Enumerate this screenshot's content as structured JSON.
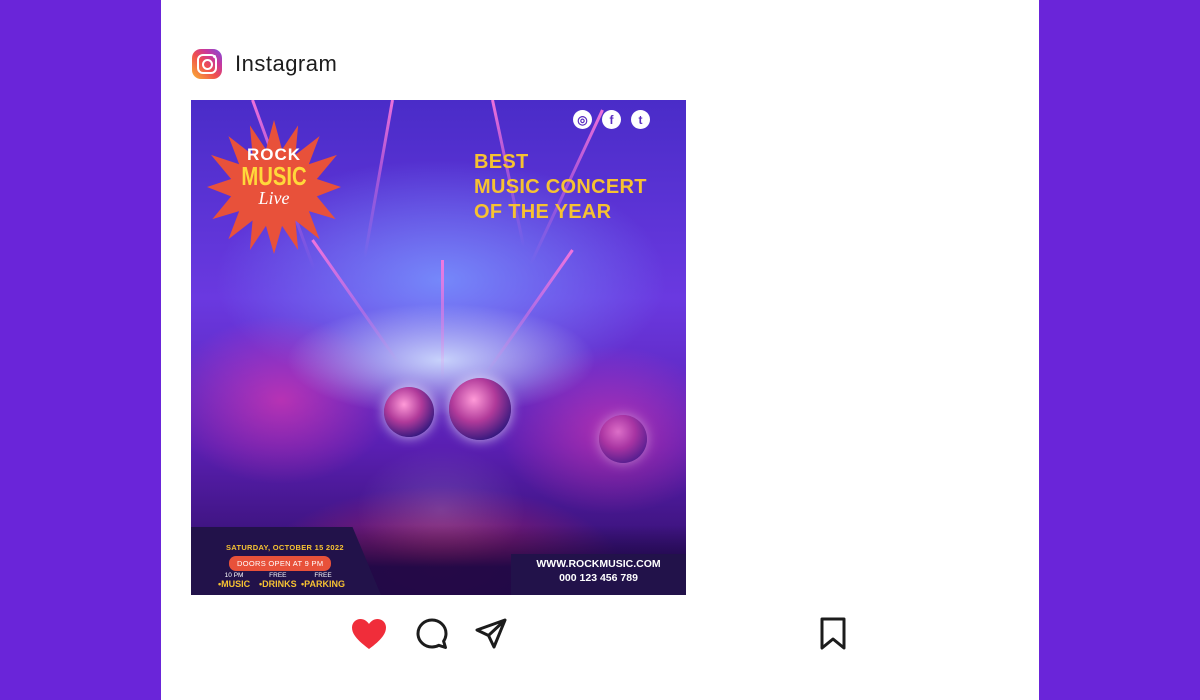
{
  "app": {
    "name": "Instagram"
  },
  "post": {
    "logo": {
      "line1": "ROCK",
      "line2": "MUSIC",
      "line3": "Live"
    },
    "social_icons": [
      "instagram-icon",
      "facebook-icon",
      "twitter-icon"
    ],
    "headline": {
      "line1": "BEST",
      "line2": "MUSIC CONCERT",
      "line3": "OF THE YEAR"
    },
    "date": "SATURDAY, OCTOBER 15 2022",
    "doors": "DOORS OPEN AT 9 PM",
    "features": [
      {
        "small": "10 PM",
        "main": "•MUSIC"
      },
      {
        "small": "FREE",
        "main": "•DRINKS"
      },
      {
        "small": "FREE",
        "main": "•PARKING"
      }
    ],
    "website": "WWW.ROCKMUSIC.COM",
    "phone": "000 123 456 789"
  },
  "actions": {
    "icons": [
      "heart-icon",
      "comment-icon",
      "share-icon",
      "bookmark-icon"
    ],
    "liked": true,
    "heart_color": "#f02d3a"
  },
  "colors": {
    "background": "#6a25d9",
    "card": "#ffffff",
    "headline": "#f6c232",
    "accent": "#e8513a"
  }
}
